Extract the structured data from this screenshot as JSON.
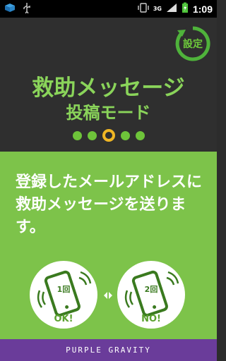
{
  "status_bar": {
    "network": "3G",
    "time": "1:09"
  },
  "settings": {
    "label": "設定"
  },
  "title": {
    "line1": "救助メッセージ",
    "line2": "投稿モード"
  },
  "pager": {
    "total": 5,
    "active_index": 2
  },
  "message": {
    "text": "登録したメールアドレスに救助メッセージを送ります。"
  },
  "options": [
    {
      "count_label": "1回",
      "result_label": "OK!"
    },
    {
      "count_label": "2回",
      "result_label": "NO!"
    }
  ],
  "footer": {
    "brand": "PURPLE GRAVITY"
  },
  "colors": {
    "accent_green": "#7dc34a",
    "title_green": "#8ad45a",
    "active_dot": "#f0b624",
    "footer_purple": "#6a3c9a"
  }
}
